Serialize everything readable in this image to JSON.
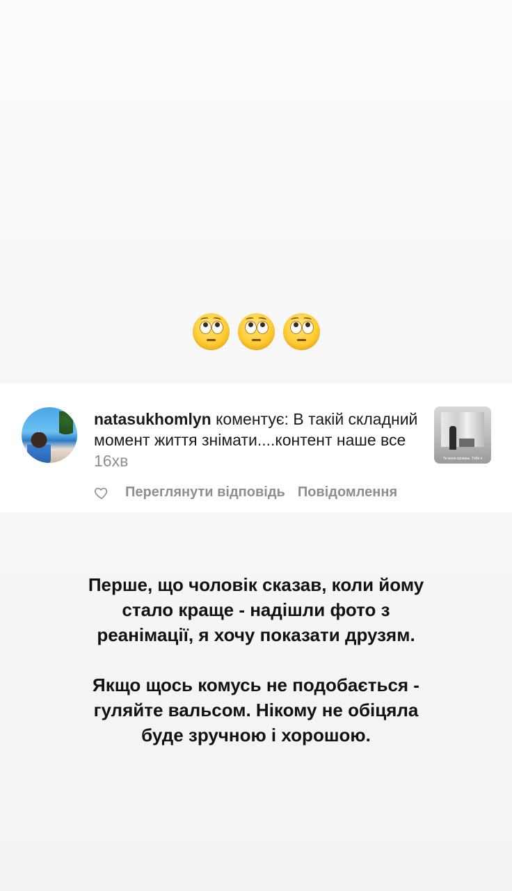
{
  "story": {
    "emojis": [
      "face-with-rolling-eyes",
      "face-with-rolling-eyes",
      "face-with-rolling-eyes"
    ],
    "paragraph1": [
      "Перше, що чоловік сказав, коли йому",
      "стало краще - надішли фото з",
      "реанімації, я хочу показати друзям."
    ],
    "paragraph2": [
      "Якщо щось комусь не подобається -",
      "гуляйте вальсом. Нікому не обіцяла",
      "буде зручною і хорошою."
    ]
  },
  "comment": {
    "username": "natasukhomlyn",
    "action": " коментує: ",
    "text": "В такій складний момент життя знімати....контент наше все",
    "time": "16хв",
    "thumbnail_caption": "Ти мене прокинь. Тебе я",
    "like_icon": "heart-outline-icon",
    "view_reply_label": "Переглянути відповідь",
    "message_label": "Повідомлення"
  },
  "colors": {
    "background": "#f5f5f5",
    "card": "#ffffff",
    "secondary_text": "#8e8e8e",
    "primary_text": "#111111"
  }
}
